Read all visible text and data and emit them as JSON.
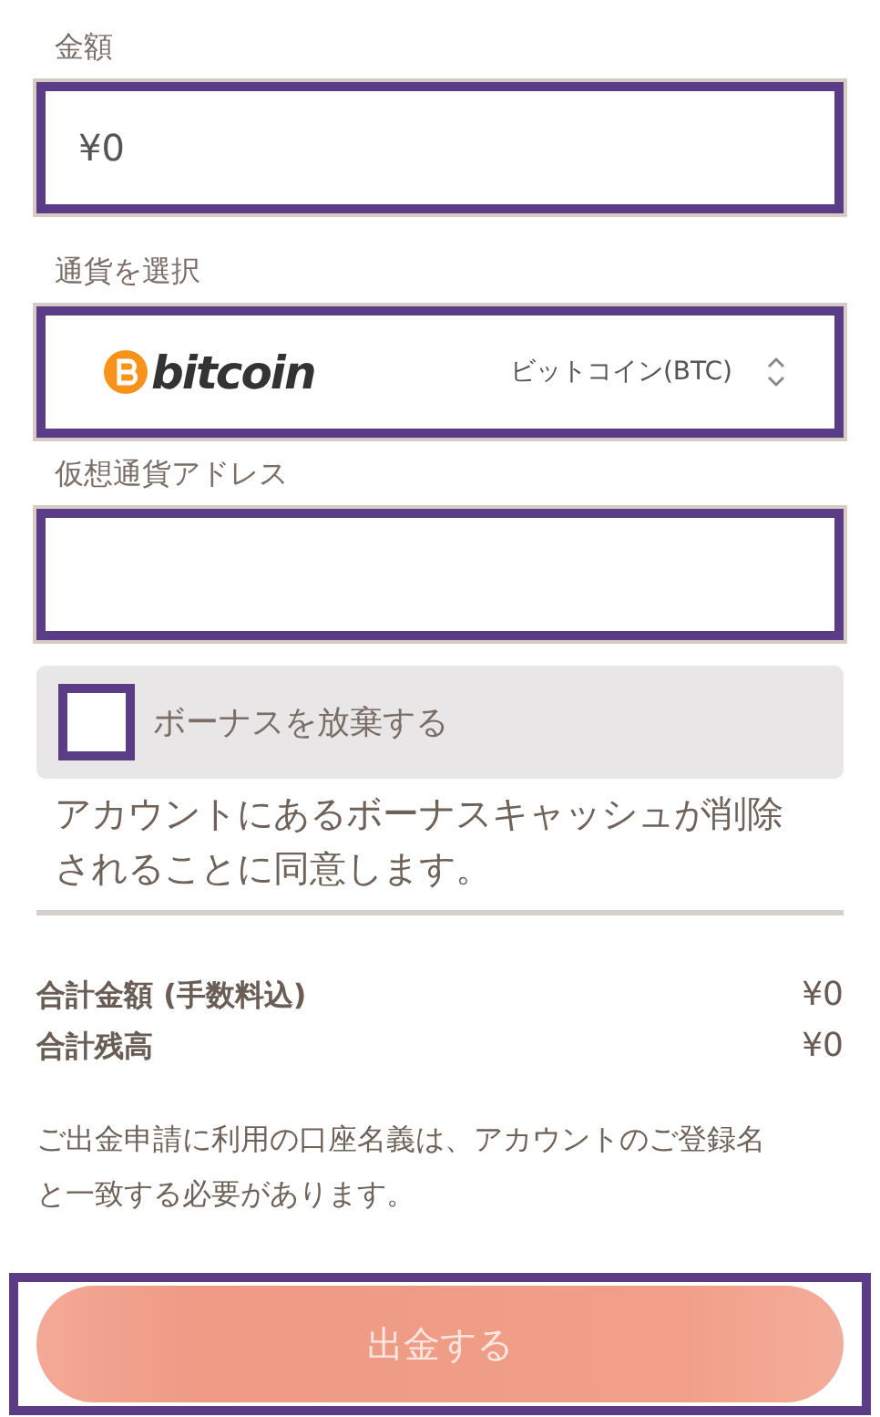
{
  "amount": {
    "label": "金額",
    "value": "¥0"
  },
  "currency": {
    "label": "通貨を選択",
    "logo_text": "bitcoin",
    "value": "ビットコイン(BTC)"
  },
  "address": {
    "label": "仮想通貨アドレス"
  },
  "bonus": {
    "label": "ボーナスを放棄する",
    "checked": false,
    "description": "アカウントにあるボーナスキャッシュが削除されることに同意します。"
  },
  "totals": [
    {
      "label": "合計金額 (手数料込)",
      "value": "¥0"
    },
    {
      "label": "合計残高",
      "value": "¥0"
    }
  ],
  "note": "ご出金申請に利用の口座名義は、アカウントのご登録名と一致する必要があります。",
  "submit": {
    "label": "出金する",
    "disabled": true
  }
}
